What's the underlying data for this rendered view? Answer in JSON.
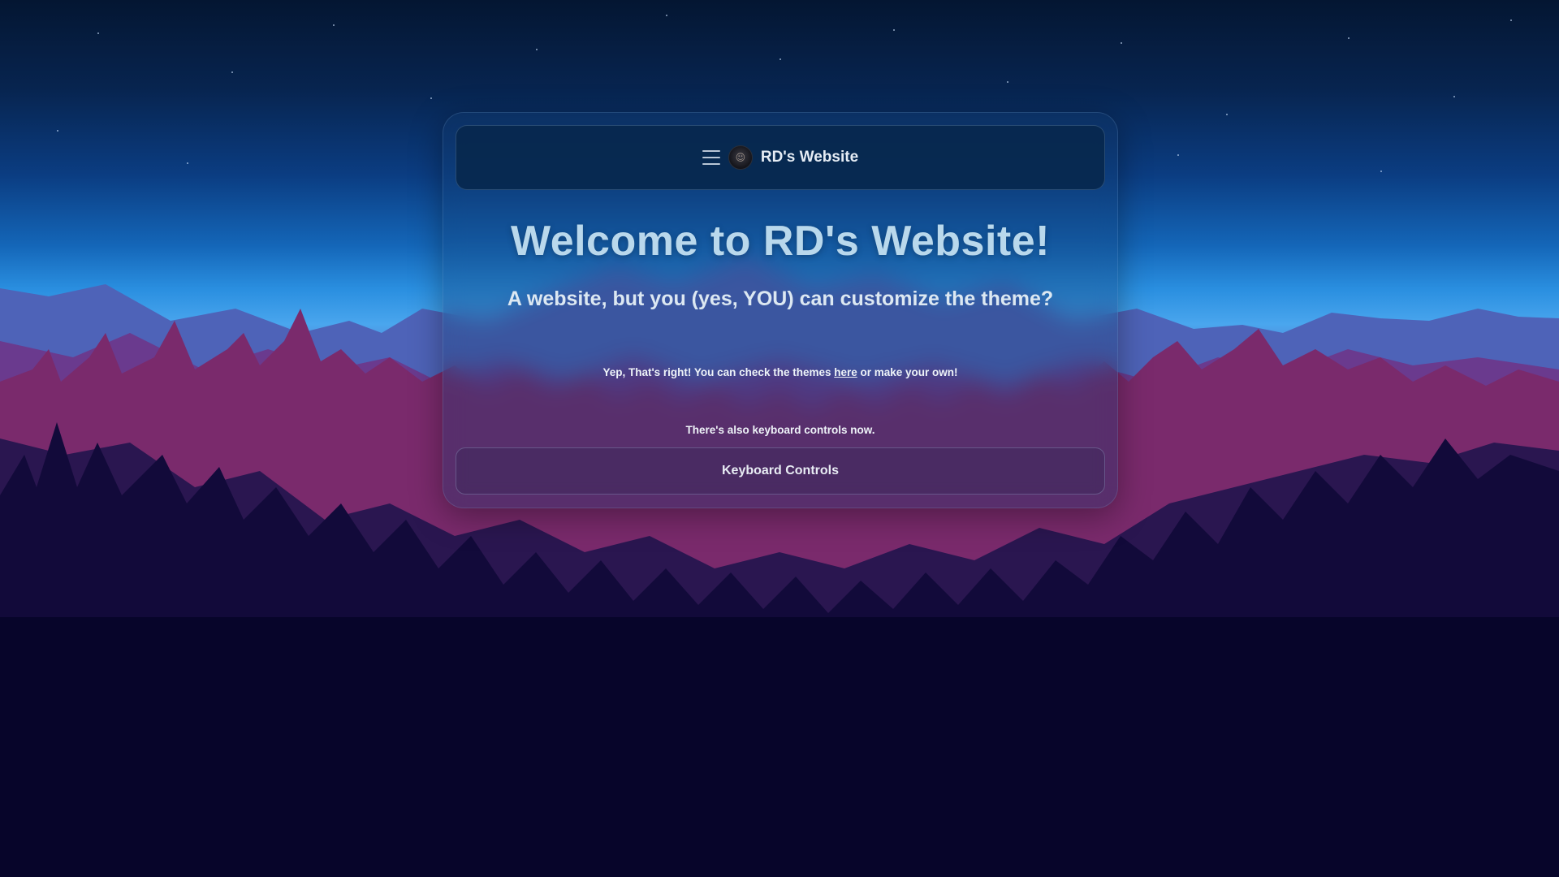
{
  "navbar": {
    "menu_icon": "hamburger-menu-icon",
    "avatar_icon": "profile-avatar",
    "site_title": "RD's Website"
  },
  "hero": {
    "heading": "Welcome to RD's Website!",
    "subtitle": "A website, but you (yes, YOU) can customize the theme?"
  },
  "notes": {
    "themes_prefix": "Yep, That's right! You can check the themes ",
    "themes_link": "here",
    "themes_suffix": " or make your own!",
    "keyboard_text": "There's also keyboard controls now."
  },
  "buttons": {
    "keyboard_controls": "Keyboard Controls"
  },
  "colors": {
    "panel_bg": "#143c6e",
    "navbar_bg": "#08284e",
    "heading_text": "#b9d8ec",
    "forest_dark": "#07052a"
  }
}
